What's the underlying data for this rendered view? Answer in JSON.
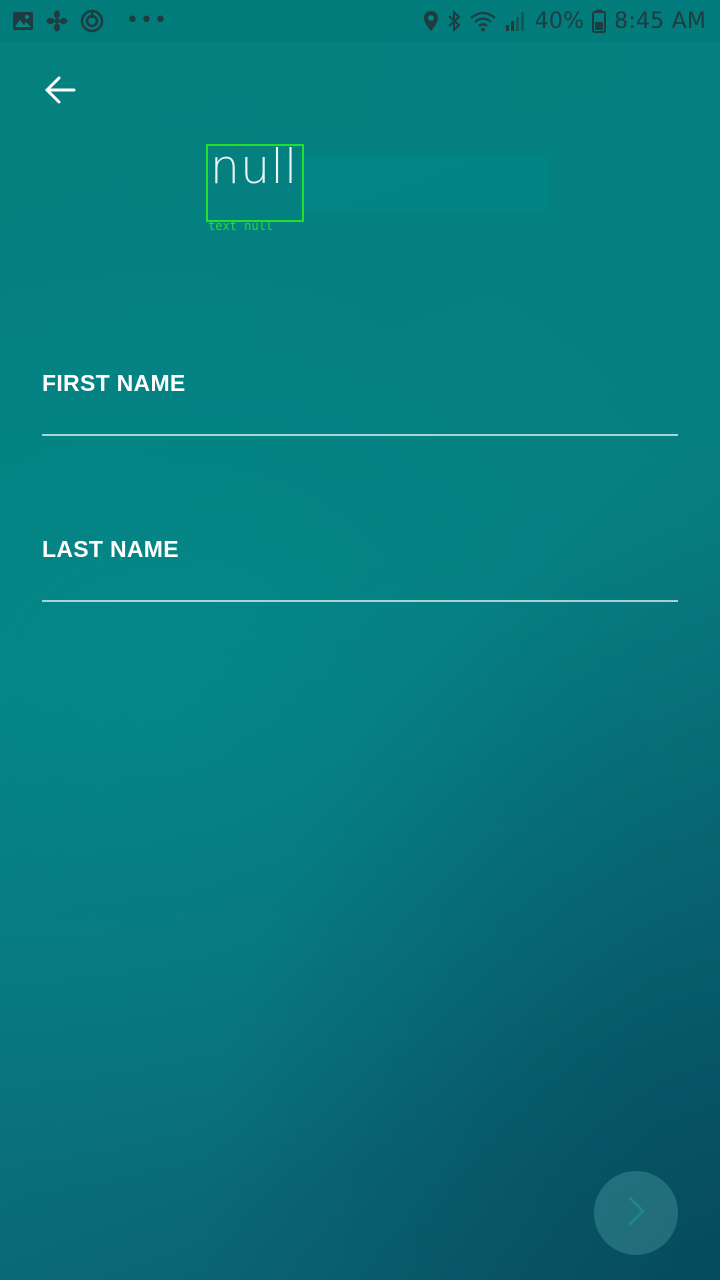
{
  "status_bar": {
    "left_icons": [
      "gallery-icon",
      "fan-icon",
      "sync-circle-icon"
    ],
    "overflow": "•••",
    "right_icons": [
      "location-icon",
      "bluetooth-icon",
      "wifi-icon",
      "signal-icon",
      "battery-icon"
    ],
    "battery": "40%",
    "time": "8:45 AM"
  },
  "header": {
    "back_icon": "arrow-left-icon",
    "title": "null",
    "title_annotation": "text null"
  },
  "form": {
    "first_name": {
      "label": "FIRST NAME",
      "value": ""
    },
    "last_name": {
      "label": "LAST NAME",
      "value": ""
    }
  },
  "next_button": {
    "icon": "chevron-right-icon"
  },
  "colors": {
    "background": "#067f80",
    "annotation_box": "#22e02a",
    "text": "#ffffff"
  }
}
